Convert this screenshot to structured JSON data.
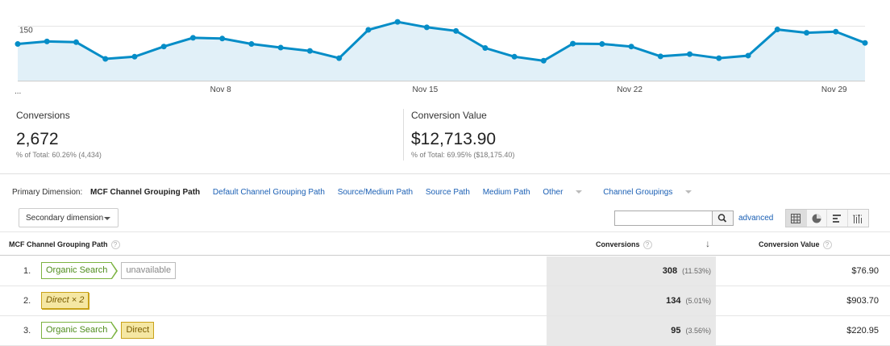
{
  "chart_data": {
    "type": "area",
    "y_tick_label": "150",
    "x_tick_labels": [
      "Nov 8",
      "Nov 15",
      "Nov 22",
      "Nov 29"
    ],
    "ellipsis": "...",
    "values": [
      101,
      108,
      106,
      60,
      66,
      94,
      118,
      116,
      101,
      91,
      82,
      62,
      140,
      162,
      147,
      137,
      90,
      66,
      55,
      102,
      101,
      94,
      67,
      73,
      62,
      69,
      141,
      132,
      135,
      104
    ],
    "ylim": [
      0,
      200
    ],
    "line_color": "#058dc7",
    "fill_color": "#e1f0f8"
  },
  "scorecards": [
    {
      "label": "Conversions",
      "value": "2,672",
      "sub": "% of Total: 60.26% (4,434)"
    },
    {
      "label": "Conversion Value",
      "value": "$12,713.90",
      "sub": "% of Total: 69.95% ($18,175.40)"
    }
  ],
  "dimensions": {
    "label": "Primary Dimension:",
    "active": "MCF Channel Grouping Path",
    "links": [
      "Default Channel Grouping Path",
      "Source/Medium Path",
      "Source Path",
      "Medium Path"
    ],
    "other": "Other",
    "channel_groupings": "Channel Groupings"
  },
  "toolbar": {
    "secondary_dimension": "Secondary dimension",
    "search_placeholder": "",
    "advanced": "advanced",
    "view_icons": [
      "table-view-icon",
      "pie-view-icon",
      "performance-view-icon",
      "comparison-view-icon"
    ]
  },
  "table": {
    "headers": {
      "path": "MCF Channel Grouping Path",
      "conversions": "Conversions",
      "sort_arrow": "↓",
      "value": "Conversion Value",
      "help": "?"
    },
    "rows": [
      {
        "index": "1.",
        "steps": [
          {
            "label": "Organic Search",
            "style": "green"
          },
          {
            "label": "unavailable",
            "style": "gray"
          }
        ],
        "conversions": "308",
        "pct": "(11.53%)",
        "value": "$76.90"
      },
      {
        "index": "2.",
        "steps": [
          {
            "label": "Direct × 2",
            "style": "yellow-outlined"
          }
        ],
        "conversions": "134",
        "pct": "(5.01%)",
        "value": "$903.70"
      },
      {
        "index": "3.",
        "steps": [
          {
            "label": "Organic Search",
            "style": "green"
          },
          {
            "label": "Direct",
            "style": "yellow"
          }
        ],
        "conversions": "95",
        "pct": "(3.56%)",
        "value": "$220.95"
      }
    ]
  }
}
